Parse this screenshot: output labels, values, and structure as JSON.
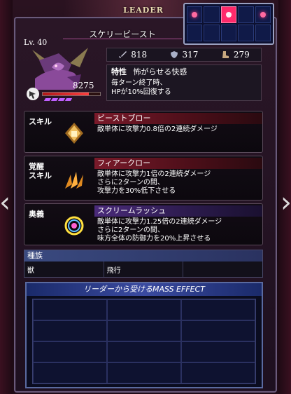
{
  "header": {
    "leader_label": "LEADER"
  },
  "unit": {
    "name": "スケリービースト",
    "level": "Lv. 40",
    "hp": "8275",
    "hp_fraction": 0.8,
    "stats": {
      "attack": "818",
      "defense": "317",
      "speed": "279"
    },
    "trait": {
      "label": "特性",
      "name": "怖がらせる快感",
      "desc_line1": "毎ターン終了時、",
      "desc_line2": "HPが10%回復する"
    }
  },
  "skills": [
    {
      "label": "スキル",
      "name": "ビーストブロー",
      "desc": "敵単体に攻撃力0.8倍の2連続ダメージ"
    },
    {
      "label_line1": "覚醒",
      "label_line2": "スキル",
      "name": "フィアークロー",
      "desc": "敵単体に攻撃力1倍の2連続ダメージ\nさらに2ターンの間、\n攻撃力を30%低下させる"
    },
    {
      "label": "奥義",
      "name": "スクリームラッシュ",
      "desc": "敵単体に攻撃力1.25倍の2連続ダメージ\nさらに2ターンの間、\n味方全体の防御力を20%上昇させる"
    }
  ],
  "tribe": {
    "header": "種族",
    "values": [
      "獣",
      "飛行",
      ""
    ]
  },
  "mass_effect": {
    "title": "リーダーから受けるMASS EFFECT"
  },
  "formation": {
    "selected_col": 2,
    "lit_cols": [
      0,
      2,
      4
    ]
  },
  "colors": {
    "accent": "#ff2a6a",
    "frame": "#6a5a7a",
    "skill_bar": "#7a1a2a",
    "ougi_bar": "#4a2a7a"
  },
  "icons": {
    "attack": "sword-icon",
    "defense": "shield-icon",
    "speed": "boot-icon"
  }
}
